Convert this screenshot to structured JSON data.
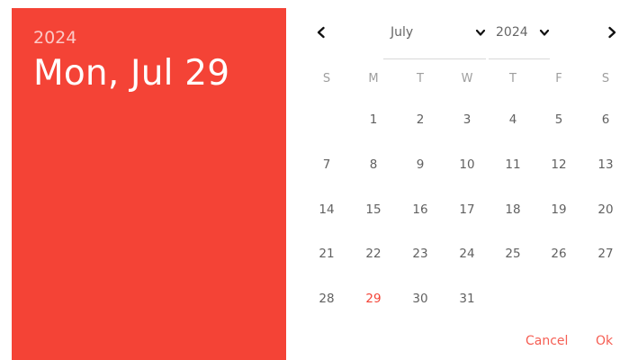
{
  "header": {
    "year": "2024",
    "date": "Mon, Jul 29"
  },
  "controls": {
    "prev_icon": "chevron-left-icon",
    "next_icon": "chevron-right-icon",
    "month_value": "July",
    "year_value": "2024",
    "dropdown_icon": "chevron-down-icon"
  },
  "weekdays": [
    "S",
    "M",
    "T",
    "W",
    "T",
    "F",
    "S"
  ],
  "weeks": [
    [
      "",
      "1",
      "2",
      "3",
      "4",
      "5",
      "6"
    ],
    [
      "7",
      "8",
      "9",
      "10",
      "11",
      "12",
      "13"
    ],
    [
      "14",
      "15",
      "16",
      "17",
      "18",
      "19",
      "20"
    ],
    [
      "21",
      "22",
      "23",
      "24",
      "25",
      "26",
      "27"
    ],
    [
      "28",
      "29",
      "30",
      "31",
      "",
      "",
      ""
    ]
  ],
  "selected_day": "29",
  "actions": {
    "cancel": "Cancel",
    "ok": "Ok"
  },
  "colors": {
    "accent": "#f44336",
    "text": "#616161",
    "muted": "#9e9e9e"
  }
}
